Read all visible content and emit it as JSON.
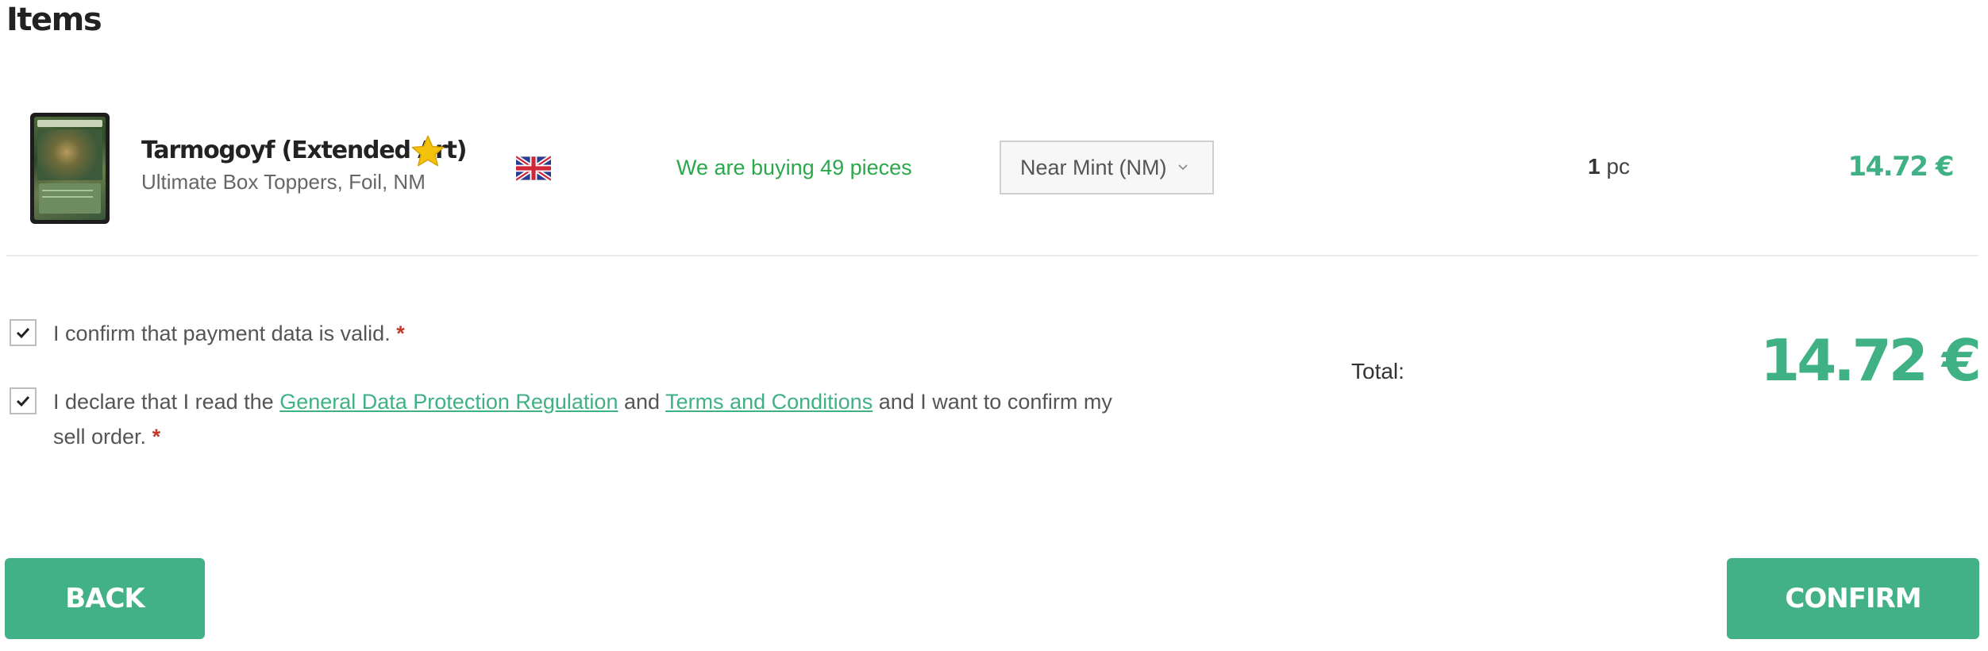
{
  "heading": "Items",
  "item": {
    "name": "Tarmogoyf (Extended Art)",
    "subtitle": "Ultimate Box Toppers, Foil, NM",
    "buying_info": "We are buying 49 pieces",
    "condition": "Near Mint (NM)",
    "quantity": "1",
    "quantity_unit": "pc",
    "price": "14.72 €",
    "icons": {
      "featured": "star-icon",
      "language": "uk-flag-icon",
      "dropdown": "chevron-down-icon"
    }
  },
  "consents": {
    "payment": {
      "text": "I confirm that payment data is valid.",
      "required_mark": "*",
      "checked": true
    },
    "gdpr": {
      "text_before": "I declare that I read the",
      "gdpr_link": "General Data Protection Regulation",
      "and": "and",
      "terms_link": "Terms and Conditions",
      "text_after": "and I want to confirm my sell order.",
      "required_mark": "*",
      "checked": true
    }
  },
  "total": {
    "label": "Total:",
    "value": "14.72 €"
  },
  "buttons": {
    "back": "BACK",
    "confirm": "CONFIRM"
  },
  "colors": {
    "accent": "#42b188",
    "price": "#3fb185",
    "buying": "#2aa84a",
    "required": "#c0392b"
  }
}
